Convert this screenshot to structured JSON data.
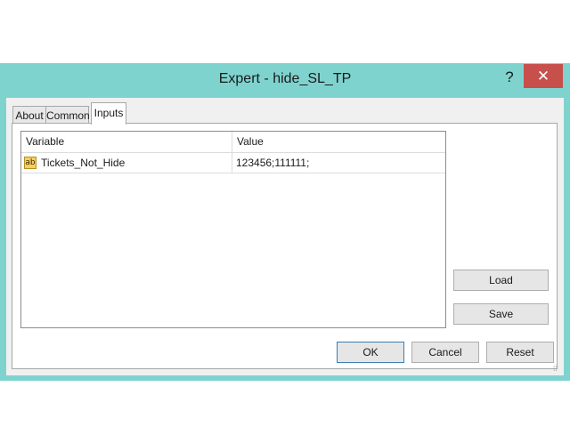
{
  "window": {
    "title": "Expert - hide_SL_TP",
    "help_glyph": "?",
    "close_glyph": "✕"
  },
  "tabs": [
    {
      "label": "About"
    },
    {
      "label": "Common"
    },
    {
      "label": "Inputs",
      "active": true
    }
  ],
  "grid": {
    "headers": {
      "variable": "Variable",
      "value": "Value"
    },
    "rows": [
      {
        "icon": "string-type-icon",
        "icon_text": "ab",
        "variable": "Tickets_Not_Hide",
        "value": "123456;111111;"
      }
    ]
  },
  "side_buttons": {
    "load": "Load",
    "save": "Save"
  },
  "footer_buttons": {
    "ok": "OK",
    "cancel": "Cancel",
    "reset": "Reset"
  },
  "colors": {
    "frame": "#7fd3ce",
    "close": "#c7504c",
    "client": "#f0f0f0"
  }
}
